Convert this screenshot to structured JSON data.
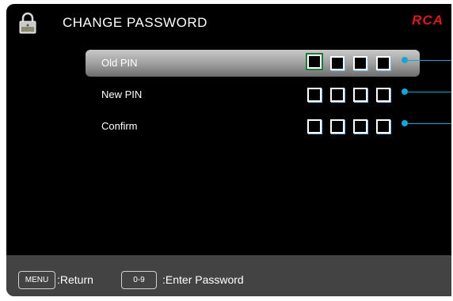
{
  "header": {
    "title": "CHANGE PASSWORD",
    "brand": "RCA",
    "icon": "lock-icon"
  },
  "form": {
    "rows": [
      {
        "label": "Old PIN",
        "selected": true,
        "filled_digits": 0
      },
      {
        "label": "New PIN",
        "selected": false,
        "filled_digits": 0
      },
      {
        "label": "Confirm",
        "selected": false,
        "filled_digits": 0
      }
    ]
  },
  "footer": {
    "menu_key": "MENU",
    "menu_action": ":Return",
    "digits_key": "0-9",
    "digits_action": ":Enter Password"
  },
  "colors": {
    "background": "#000000",
    "accent": "#15a6d6",
    "brand": "#d81920",
    "footer": "#434343",
    "focus": "#1e7a3c"
  }
}
